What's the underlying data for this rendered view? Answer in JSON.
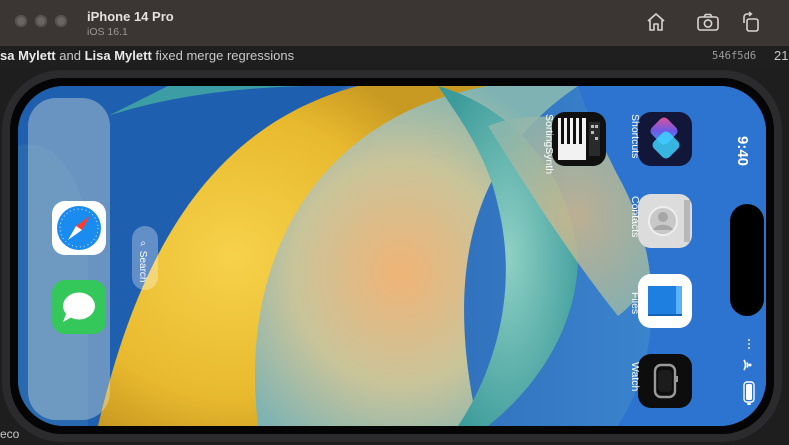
{
  "simulator": {
    "device_name": "iPhone 14 Pro",
    "os_version": "iOS 16.1",
    "toolbar_icons": [
      "home-icon",
      "screenshot-icon",
      "rotate-icon"
    ]
  },
  "background_editor": {
    "commit_author_partial": "sa Mylett",
    "commit_and": "and",
    "commit_author2": "Lisa Mylett",
    "commit_message": "fixed merge regressions",
    "commit_hash": "546f5d6",
    "commit_extra": "21",
    "bottom_text": "eco"
  },
  "phone": {
    "status": {
      "time": "9:40"
    },
    "search": {
      "label": "Search"
    },
    "apps": [
      {
        "name": "Shortcuts",
        "label": "Shortcuts",
        "icon": "shortcuts-icon"
      },
      {
        "name": "Contacts",
        "label": "Contacts",
        "icon": "contacts-icon"
      },
      {
        "name": "Files",
        "label": "Files",
        "icon": "files-icon"
      },
      {
        "name": "Watch",
        "label": "Watch",
        "icon": "watch-icon"
      },
      {
        "name": "SortingSynth",
        "label": "SortingSynth",
        "icon": "sortingsynth-icon"
      }
    ],
    "dock": [
      {
        "name": "Safari",
        "icon": "safari-icon"
      },
      {
        "name": "Messages",
        "icon": "messages-icon"
      }
    ]
  },
  "colors": {
    "titlebar": "#3b3634",
    "wallpaper_yellow": "#f0c537",
    "wallpaper_blue": "#2d6fd0"
  }
}
